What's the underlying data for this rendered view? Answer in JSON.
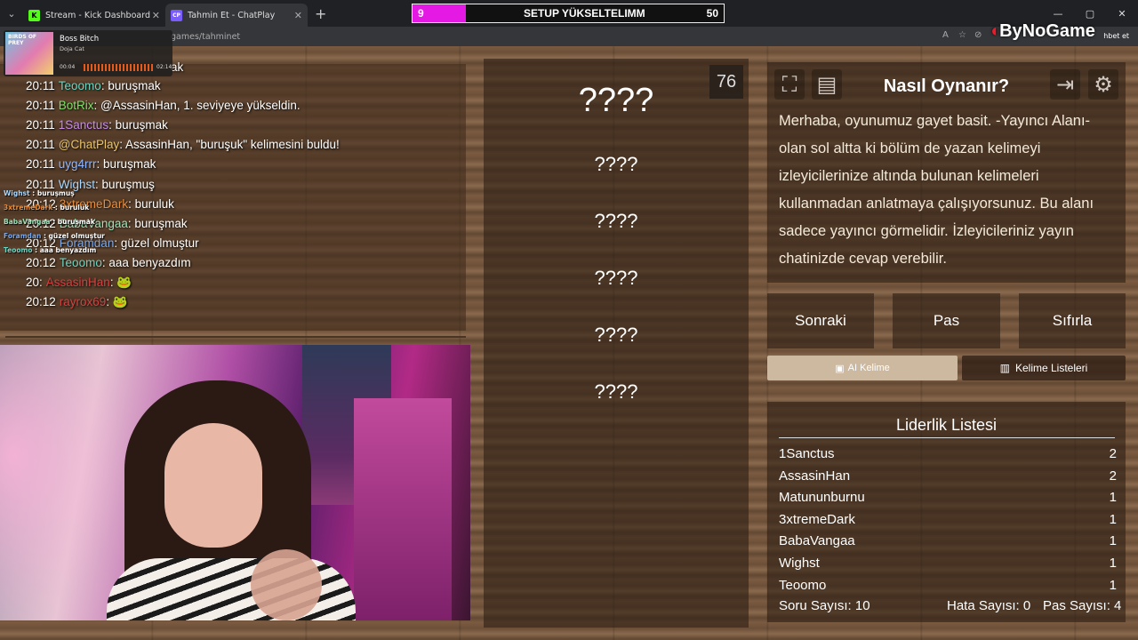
{
  "browser": {
    "tabs": [
      {
        "title": "Stream - Kick Dashboard",
        "favicon": "K"
      },
      {
        "title": "Tahmin Et - ChatPlay",
        "favicon": "CP"
      }
    ],
    "url": "games/tahminet",
    "right_label": "hbet et"
  },
  "goal_bar": {
    "left": "9",
    "title": "SETUP YÜKSELTELIMM",
    "right": "50",
    "progress": 0.17
  },
  "logo": {
    "text": "ByNoGame"
  },
  "music": {
    "art_text": "BIRDS OF PREY",
    "title": "Boss Bitch",
    "artist": "Doja Cat",
    "elapsed": "00:04",
    "duration": "02:14"
  },
  "chat": {
    "partial_top": "ak",
    "lines": [
      {
        "time": "20:11",
        "user": "Teoomo",
        "color": "#6fd3c0",
        "msg": ": buruşmak"
      },
      {
        "time": "20:11",
        "user": "BotRix",
        "color": "#7ee06a",
        "msg": ": @AssasinHan, 1. seviyeye yükseldin."
      },
      {
        "time": "20:11",
        "user": "1Sanctus",
        "color": "#c88ce8",
        "msg": ": buruşmak"
      },
      {
        "time": "20:11",
        "user": "@ChatPlay",
        "color": "#e8c36a",
        "msg": ": AssasinHan, \"buruşuk\" kelimesini buldu!"
      },
      {
        "time": "20:11",
        "user": "uyg4rrr",
        "color": "#8fb6ff",
        "msg": ": buruşmak"
      },
      {
        "time": "20:11",
        "user": "Wighst",
        "color": "#a8d8ff",
        "msg": ": buruşmuş"
      },
      {
        "time": "20:12",
        "user": "3xtremeDark",
        "color": "#e88c3a",
        "msg": ": buruluk"
      },
      {
        "time": "20:12",
        "user": "BabaVangaa",
        "color": "#9ee0b8",
        "msg": ": buruşmak"
      },
      {
        "time": "20:12",
        "user": "Foramdan",
        "color": "#7aa8e8",
        "msg": ": güzel olmuştur"
      },
      {
        "time": "20:12",
        "user": "Teoomo",
        "color": "#6fd3c0",
        "msg": ": aaa benyazdım"
      },
      {
        "time": "20:",
        "user": "AssasinHan",
        "color": "#d44040",
        "msg": ": 🐸"
      },
      {
        "time": "20:12",
        "user": "rayrox69",
        "color": "#d44040",
        "msg": ": 🐸"
      }
    ],
    "overlay": [
      {
        "user": "Wighst",
        "color": "#a8d8ff",
        "msg": " : buruşmuş"
      },
      {
        "user": "3xtremeDark",
        "color": "#e88c3a",
        "msg": " : buruluk"
      },
      {
        "user": "BabaVangaa",
        "color": "#9ee0b8",
        "msg": " : buruşmak"
      },
      {
        "user": "Foramdan",
        "color": "#7aa8e8",
        "msg": " : güzel olmuştur"
      },
      {
        "user": "Teoomo",
        "color": "#6fd3c0",
        "msg": " : aaa benyazdım"
      }
    ]
  },
  "game": {
    "timer": "76",
    "main_word": "????",
    "hidden_words": [
      "????",
      "????",
      "????",
      "????",
      "????"
    ]
  },
  "howto": {
    "title": "Nasıl Oynanır?",
    "description": "Merhaba, oyunumuz gayet basit. -Yayıncı Alanı- olan sol altta ki bölüm de yazan kelimeyi izleyicilerinize altında bulunan kelimeleri kullanmadan anlatmaya çalışıyorsunuz. Bu alanı sadece yayıncı görmelidir. İzleyicileriniz yayın chatinizde cevap verebilir."
  },
  "controls": {
    "next": "Sonraki",
    "pass": "Pas",
    "reset": "Sıfırla",
    "ai_word": "AI Kelime",
    "word_lists": "Kelime Listeleri"
  },
  "leaderboard": {
    "title": "Liderlik Listesi",
    "rows": [
      {
        "name": "1Sanctus",
        "score": "2"
      },
      {
        "name": "AssasinHan",
        "score": "2"
      },
      {
        "name": "Matununburnu",
        "score": "1"
      },
      {
        "name": "3xtremeDark",
        "score": "1"
      },
      {
        "name": "BabaVangaa",
        "score": "1"
      },
      {
        "name": "Wighst",
        "score": "1"
      },
      {
        "name": "Teoomo",
        "score": "1"
      }
    ],
    "question_count": "Soru Sayısı: 10",
    "error_count": "Hata Sayısı: 0",
    "pass_count": "Pas Sayısı: 4"
  }
}
